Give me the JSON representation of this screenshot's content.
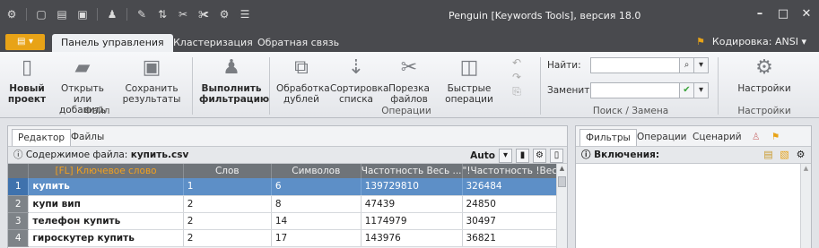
{
  "window": {
    "title": "Penguin [Keywords Tools], версия 18.0",
    "minimize_icon": "minimize-icon",
    "maximize_icon": "maximize-icon",
    "close_icon": "close-icon"
  },
  "ribbon_tabs": {
    "file_label": "",
    "tabs": [
      "Панель управления",
      "Кластеризация",
      "Обратная связь"
    ],
    "active": "Панель управления",
    "encoding_label": "Кодировка: ANSI"
  },
  "ribbon": {
    "new_project": "Новый проект",
    "open_add": "Открыть или добавить",
    "save_results": "Сохранить результаты",
    "group_file": "Файл",
    "run_filtering": "Выполнить фильтрацию",
    "dup_processing": "Обработка дублей",
    "list_sort": "Сортировка списка",
    "file_cut": "Порезка файлов",
    "quick_ops": "Быстрые операции",
    "group_operations": "Операции",
    "find_label": "Найти:",
    "replace_label": "Заменить:",
    "find_value": "",
    "replace_value": "",
    "group_search": "Поиск / Замена",
    "settings": "Настройки",
    "group_settings": "Настройки"
  },
  "left_pane": {
    "tabs": [
      "Редактор",
      "Файлы"
    ],
    "active_tab": "Редактор",
    "file_contents_label": "Содержимое файла:",
    "file_name": "купить.csv",
    "auto_label": "Auto",
    "columns": [
      "",
      "[FL] Ключевое слово",
      "Слов",
      "Символов",
      "Частотность Весь ...",
      "\"!Частотность !Вес..."
    ],
    "rows": [
      {
        "n": "1",
        "keyword": "купить",
        "words": "1",
        "chars": "6",
        "freq": "139729810",
        "freq_exact": "326484"
      },
      {
        "n": "2",
        "keyword": "купи вип",
        "words": "2",
        "chars": "8",
        "freq": "47439",
        "freq_exact": "24850"
      },
      {
        "n": "3",
        "keyword": "телефон купить",
        "words": "2",
        "chars": "14",
        "freq": "1174979",
        "freq_exact": "30497"
      },
      {
        "n": "4",
        "keyword": "гироскутер купить",
        "words": "2",
        "chars": "17",
        "freq": "143976",
        "freq_exact": "36821"
      }
    ],
    "selected_row": 0
  },
  "right_pane": {
    "tabs": [
      "Фильтры",
      "Операции",
      "Сценарий"
    ],
    "active_tab": "Фильтры",
    "inclusions_label": "Включения:"
  }
}
